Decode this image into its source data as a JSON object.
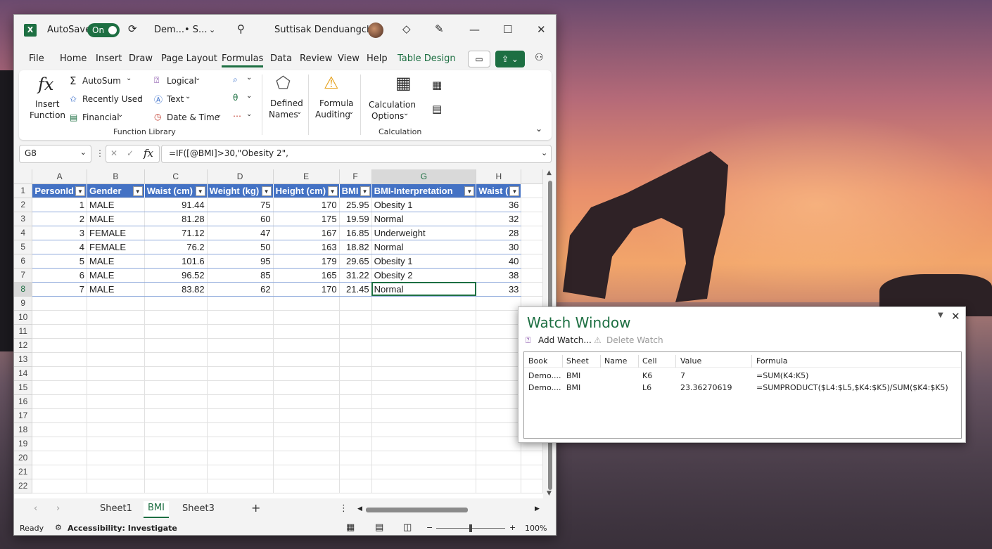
{
  "titlebar": {
    "app_icon": "excel-icon",
    "autosave_label": "AutoSave",
    "autosave_state": "On",
    "doc_name": "Dem...",
    "doc_status": "• S...",
    "user_name": "Suttisak Denduangchai"
  },
  "menu": {
    "tabs": [
      "File",
      "Home",
      "Insert",
      "Draw",
      "Page Layout",
      "Formulas",
      "Data",
      "Review",
      "View",
      "Help",
      "Table Design"
    ],
    "active": "Formulas"
  },
  "ribbon": {
    "insert_function": [
      "Insert",
      "Function"
    ],
    "autosum": "AutoSum",
    "recently_used": "Recently Used",
    "financial": "Financial",
    "logical": "Logical",
    "text": "Text",
    "date_time": "Date & Time",
    "function_library": "Function Library",
    "defined_names": [
      "Defined",
      "Names"
    ],
    "formula_auditing": [
      "Formula",
      "Auditing"
    ],
    "calculation_options": [
      "Calculation",
      "Options"
    ],
    "calculation": "Calculation"
  },
  "formula_bar": {
    "name_box": "G8",
    "formula": "=IF([@BMI]>30,\"Obesity 2\","
  },
  "grid": {
    "columns": [
      "A",
      "B",
      "C",
      "D",
      "E",
      "F",
      "G",
      "H"
    ],
    "selected_column": "G",
    "selected_row": 8,
    "headers": [
      "PersonId",
      "Gender",
      "Waist (cm)",
      "Weight (kg)",
      "Height (cm)",
      "BMI",
      "BMI-Interpretation",
      "Waist ("
    ],
    "rows": [
      [
        "1",
        "MALE",
        "91.44",
        "75",
        "170",
        "25.95",
        "Obesity 1",
        "36"
      ],
      [
        "2",
        "MALE",
        "81.28",
        "60",
        "175",
        "19.59",
        "Normal",
        "32"
      ],
      [
        "3",
        "FEMALE",
        "71.12",
        "47",
        "167",
        "16.85",
        "Underweight",
        "28"
      ],
      [
        "4",
        "FEMALE",
        "76.2",
        "50",
        "163",
        "18.82",
        "Normal",
        "30"
      ],
      [
        "5",
        "MALE",
        "101.6",
        "95",
        "179",
        "29.65",
        "Obesity 1",
        "40"
      ],
      [
        "6",
        "MALE",
        "96.52",
        "85",
        "165",
        "31.22",
        "Obesity 2",
        "38"
      ],
      [
        "7",
        "MALE",
        "83.82",
        "62",
        "170",
        "21.45",
        "Normal",
        "33"
      ]
    ],
    "row_numbers": [
      "1",
      "2",
      "3",
      "4",
      "5",
      "6",
      "7",
      "8",
      "9",
      "10",
      "11",
      "12",
      "13",
      "14",
      "15",
      "16",
      "17",
      "18",
      "19",
      "20",
      "21",
      "22"
    ]
  },
  "sheets": {
    "tabs": [
      "Sheet1",
      "BMI",
      "Sheet3"
    ],
    "active": "BMI"
  },
  "status": {
    "ready": "Ready",
    "accessibility": "Accessibility: Investigate",
    "zoom": "100%"
  },
  "watch_window": {
    "title": "Watch Window",
    "add_watch": "Add Watch...",
    "delete_watch": "Delete Watch",
    "columns": [
      "Book",
      "Sheet",
      "Name",
      "Cell",
      "Value",
      "Formula"
    ],
    "rows": [
      [
        "Demo....",
        "BMI",
        "",
        "K6",
        "7",
        "=SUM(K4:K5)"
      ],
      [
        "Demo....",
        "BMI",
        "",
        "L6",
        "23.36270619",
        "=SUMPRODUCT($L4:$L5,$K4:$K5)/SUM($K4:$K5)"
      ]
    ]
  }
}
